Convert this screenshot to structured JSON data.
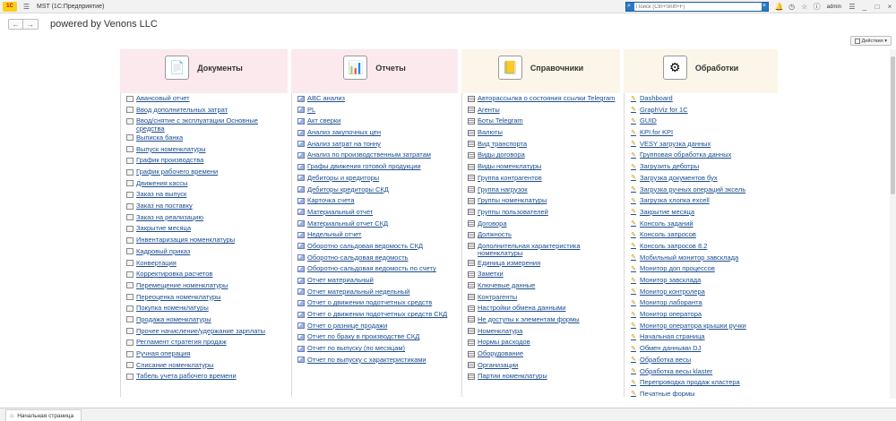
{
  "titlebar": {
    "logo": "1С",
    "title": "MST  (1С:Предприятие)",
    "search_placeholder": "Поиск (Ctrl+Shift+F)",
    "user": "admin"
  },
  "nav": {
    "back": "←",
    "forward": "→",
    "page_title": "powered by Venons LLC"
  },
  "actions_label": "Действия ▾",
  "columns": [
    {
      "title": "Документы",
      "icon": "documents-icon",
      "items": [
        "Авансовый отчет",
        "Ввод дополнительных затрат",
        "Ввод/снятие с эксплуатации Основные средства",
        "Выписка банка",
        "Выпуск номенклатуры",
        "График производства",
        "График рабочего времени",
        "Движения кассы",
        "Заказ на выпуск",
        "Заказ на поставку",
        "Заказ на реализацию",
        "Закрытие месяца",
        "Инвентаризация номенклатуры",
        "Кадровый приказ",
        "Конвертация",
        "Корректировка расчетов",
        "Перемещение номенклатуры",
        "Переоценка номенклатуры",
        "Покупка номенклатуры",
        "Продажа номенклатуры",
        "Прочее начисление/удержание зарплаты",
        "Регламент стратегия продаж",
        "Ручная операция",
        "Списание номенклатуры",
        "Табель учета рабочего времени"
      ]
    },
    {
      "title": "Отчеты",
      "icon": "reports-icon",
      "items": [
        "ABC анализ",
        "PL",
        "Акт сверки",
        "Анализ закупочных цен",
        "Анализ затрат на тонну",
        "Анализ по производственным затратам",
        "Графы движения готовой продукции",
        "Дебиторы и кредиторы",
        "Дебиторы кредиторы СКД",
        "Карточка счета",
        "Материальный отчет",
        "Материальный отчет СКД",
        "Недельный отчет",
        "Оборотно сальдовая ведомость СКД",
        "Оборотно-сальдовая ведомость",
        "Оборотно-сальдовая ведомость по счету",
        "Отчет материальный",
        "Отчет материальный недельный",
        "Отчет о движении подотчетных средств",
        "Отчет о движении подотчетных средств СКД",
        "Отчет о разнице продажи",
        "Отчет по браку в производстве СКД",
        "Отчет по выпуску (по месяцам)",
        "Отчет по выпуску с характеристиками"
      ]
    },
    {
      "title": "Справочники",
      "icon": "catalogs-icon",
      "items": [
        "Авторассылка о состояния ссылки Telegram",
        "Агенты",
        "Боты Telegram",
        "Валюты",
        "Вид транспорта",
        "Виды договора",
        "Виды номенклатуры",
        "Группа контрагентов",
        "Группа нагрузок",
        "Группы номенклатуры",
        "Группы пользователей",
        "Договора",
        "Должность",
        "Дополнительная характеристика номенклатуры",
        "Единица измерения",
        "Заметки",
        "Ключевые данные",
        "Контрагенты",
        "Настройки обмена данными",
        "Не доступы к элементам формы",
        "Номенклатура",
        "Нормы расходов",
        "Оборудование",
        "Организации",
        "Партии номенклатуры"
      ]
    },
    {
      "title": "Обработки",
      "icon": "processing-icon",
      "items": [
        "Dashboard",
        "GraphViz for 1C",
        "GUID",
        "KPI for KPI",
        "VESY загрузка данных",
        "Групповая обработка данных",
        "Загрузить деботры",
        "Загрузка документов бух",
        "Загрузка ручных операций эксель",
        "Загрузка хлопка excell",
        "Закрытие месяца",
        "Консоль заданий",
        "Консоль запросов",
        "Консоль запросов 8.2",
        "Мобильный монитор завсклада",
        "Монитор доп процессов",
        "Монитор завсклада",
        "Монитор контролера",
        "Монитор лаборанта",
        "Монитор оператора",
        "Монитор оператора крышки ручки",
        "Начальная страница",
        "Обмен данными DJ",
        "Обработка весы",
        "Обработка весы klaster",
        "Перепроводка продаж кластера",
        "Печатные формы"
      ]
    }
  ],
  "bottom_tab": "Начальная страница"
}
